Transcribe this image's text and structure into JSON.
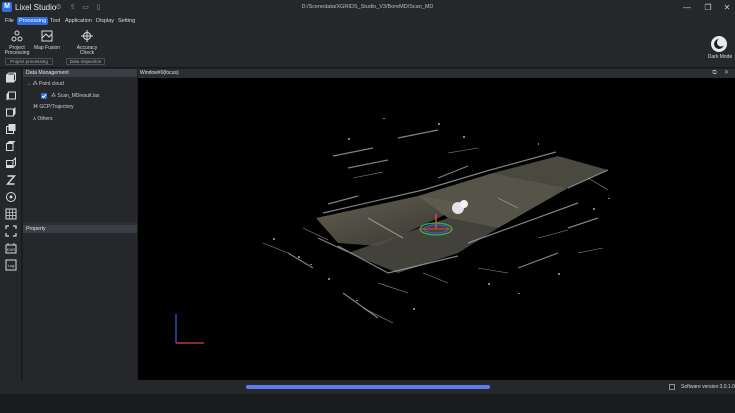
{
  "titlebar": {
    "logo_letter": "M",
    "app_name": "Lixel Studio",
    "path": "D:/Scenedata/XGRIDS_Studio_V3/BoreMD/Scan_MD",
    "minimize": "—",
    "maximize": "❐",
    "close": "✕"
  },
  "menu": [
    "File",
    "Processing",
    "Tool",
    "Application",
    "Display",
    "Setting"
  ],
  "menu_active": "Processing",
  "ribbon": {
    "buttons": [
      {
        "line1": "Project",
        "line2": "Processing",
        "icon": "project-processing-icon"
      },
      {
        "line1": "Map Fusion",
        "line2": "",
        "icon": "map-fusion-icon"
      },
      {
        "line1": "Accuracy",
        "line2": "Check",
        "icon": "accuracy-check-icon"
      }
    ],
    "groups": [
      "Project processing",
      "Data inspection"
    ],
    "dark_mode": "Dark Mode"
  },
  "left_tools": [
    "cube-front-icon",
    "cube-left-icon",
    "cube-right-icon",
    "cube-back-icon",
    "cube-top-icon",
    "cube-bottom-icon",
    "z-axis-icon",
    "point-icon",
    "grid-icon",
    "fullscreen-icon",
    "ear-icon",
    "log-icon"
  ],
  "left_tool_labels": {
    "ear": "EAR",
    "log": "Log"
  },
  "data_panel": {
    "title": "Data Management",
    "tree": {
      "point_cloud": "Point cloud",
      "scan_file": "Scan_MDresult.las",
      "gcp": "GCP/Trajectory",
      "others": "Others"
    },
    "property_title": "Property"
  },
  "viewport": {
    "title": "Window#0(focus)"
  },
  "status": {
    "progress": 1.0,
    "version": "Software version:3.0.1.0"
  },
  "colors": {
    "accent": "#2f6fe0",
    "progress": "#5b7df0",
    "background": "#1e1f22",
    "panel": "#25272b"
  }
}
